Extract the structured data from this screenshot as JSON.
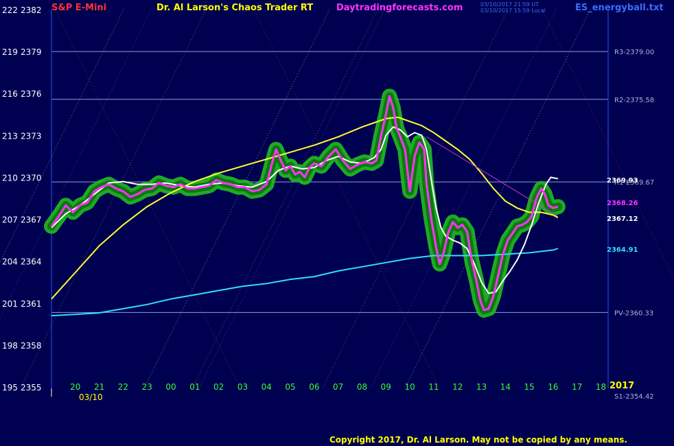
{
  "header": {
    "instrument": "S&P E-Mini",
    "title": "Dr. Al Larson's Chaos Trader RT",
    "website": "Daytradingforecasts.com",
    "file": "ES_energyball.txt",
    "stamp1": "03/10/2017 21:59 UT",
    "stamp2": "03/10/2017 15:59 Local"
  },
  "footer": {
    "copyright": "Copyright 2017, Dr. Al Larson. May not be copied by any means."
  },
  "colors": {
    "background": "#000050",
    "price_glow": "#22bb22",
    "price_core": "#ff33ff",
    "white_ma": "#ffffff",
    "yellow_ma": "#ffff33",
    "cyan_ma": "#33ddff",
    "level_line": "#8aa0d8",
    "axis": "#2255ff"
  },
  "chart_data": {
    "type": "line",
    "title": "S&P E-Mini",
    "date_label": "03/10",
    "year_label": "2017",
    "x_tick_labels": [
      "20",
      "21",
      "22",
      "23",
      "00",
      "01",
      "02",
      "03",
      "04",
      "05",
      "06",
      "07",
      "08",
      "09",
      "10",
      "11",
      "12",
      "13",
      "14",
      "15",
      "16",
      "17",
      "18"
    ],
    "y_ticks": [
      {
        "left": "222",
        "price": "2382"
      },
      {
        "left": "219",
        "price": "2379"
      },
      {
        "left": "216",
        "price": "2376"
      },
      {
        "left": "213",
        "price": "2373"
      },
      {
        "left": "210",
        "price": "2370"
      },
      {
        "left": "207",
        "price": "2367"
      },
      {
        "left": "204",
        "price": "2364"
      },
      {
        "left": "201",
        "price": "2361"
      },
      {
        "left": "198",
        "price": "2358"
      },
      {
        "left": "195",
        "price": "2355"
      }
    ],
    "ylim": [
      2355,
      2382
    ],
    "xlim": [
      19,
      42.3
    ],
    "levels": [
      {
        "name": "R3",
        "label": "R3-2379.00",
        "value": 2379.0
      },
      {
        "name": "R2",
        "label": "R2-2375.58",
        "value": 2375.58
      },
      {
        "name": "R1",
        "label": "R1-2369.67",
        "value": 2369.67
      },
      {
        "name": "PV",
        "label": "PV-2360.33",
        "value": 2360.33
      },
      {
        "name": "S1",
        "label": "S1-2354.42",
        "value": 2354.42
      }
    ],
    "last_values": [
      {
        "series": "white",
        "label": "2369.93",
        "value": 2369.93
      },
      {
        "series": "magenta",
        "label": "2368.26",
        "value": 2368.26
      },
      {
        "series": "yellow",
        "label": "2367.12",
        "value": 2367.12
      },
      {
        "series": "cyan",
        "label": "2364.91",
        "value": 2364.91
      }
    ],
    "series": [
      {
        "key": "price",
        "color": "#ff33ff",
        "points": [
          [
            19.0,
            2366.5
          ],
          [
            19.3,
            2367.2
          ],
          [
            19.6,
            2368.0
          ],
          [
            19.9,
            2367.5
          ],
          [
            20.2,
            2368.0
          ],
          [
            20.5,
            2368.2
          ],
          [
            20.8,
            2369.0
          ],
          [
            21.1,
            2369.3
          ],
          [
            21.4,
            2369.5
          ],
          [
            21.7,
            2369.2
          ],
          [
            22.0,
            2369.0
          ],
          [
            22.3,
            2368.6
          ],
          [
            22.6,
            2368.8
          ],
          [
            22.9,
            2369.1
          ],
          [
            23.2,
            2369.2
          ],
          [
            23.5,
            2369.6
          ],
          [
            23.8,
            2369.4
          ],
          [
            24.1,
            2369.3
          ],
          [
            24.4,
            2369.5
          ],
          [
            24.7,
            2369.2
          ],
          [
            25.0,
            2369.2
          ],
          [
            25.3,
            2369.3
          ],
          [
            25.6,
            2369.4
          ],
          [
            25.9,
            2369.8
          ],
          [
            26.2,
            2369.6
          ],
          [
            26.5,
            2369.5
          ],
          [
            26.8,
            2369.3
          ],
          [
            27.1,
            2369.3
          ],
          [
            27.4,
            2369.0
          ],
          [
            27.7,
            2369.1
          ],
          [
            28.0,
            2369.5
          ],
          [
            28.2,
            2370.8
          ],
          [
            28.4,
            2372.0
          ],
          [
            28.6,
            2371.2
          ],
          [
            28.8,
            2370.5
          ],
          [
            29.0,
            2370.8
          ],
          [
            29.2,
            2370.2
          ],
          [
            29.4,
            2370.4
          ],
          [
            29.6,
            2370.0
          ],
          [
            29.8,
            2370.7
          ],
          [
            30.0,
            2371.0
          ],
          [
            30.3,
            2370.8
          ],
          [
            30.6,
            2371.5
          ],
          [
            30.9,
            2372.0
          ],
          [
            31.2,
            2371.2
          ],
          [
            31.5,
            2370.6
          ],
          [
            31.8,
            2370.9
          ],
          [
            32.1,
            2371.1
          ],
          [
            32.4,
            2371.0
          ],
          [
            32.6,
            2371.2
          ],
          [
            32.8,
            2373.0
          ],
          [
            33.0,
            2374.5
          ],
          [
            33.15,
            2375.8
          ],
          [
            33.3,
            2375.0
          ],
          [
            33.45,
            2373.5
          ],
          [
            33.6,
            2372.9
          ],
          [
            33.8,
            2372.0
          ],
          [
            34.0,
            2369.0
          ],
          [
            34.2,
            2371.5
          ],
          [
            34.4,
            2372.5
          ],
          [
            34.6,
            2372.0
          ],
          [
            34.7,
            2369.5
          ],
          [
            34.9,
            2367.0
          ],
          [
            35.1,
            2365.0
          ],
          [
            35.25,
            2363.8
          ],
          [
            35.4,
            2364.5
          ],
          [
            35.6,
            2366.0
          ],
          [
            35.8,
            2366.8
          ],
          [
            36.0,
            2366.4
          ],
          [
            36.2,
            2366.6
          ],
          [
            36.4,
            2366.1
          ],
          [
            36.5,
            2365.0
          ],
          [
            36.6,
            2364.0
          ],
          [
            36.8,
            2362.5
          ],
          [
            36.95,
            2361.2
          ],
          [
            37.1,
            2360.5
          ],
          [
            37.3,
            2360.6
          ],
          [
            37.5,
            2361.5
          ],
          [
            37.7,
            2363.0
          ],
          [
            37.9,
            2364.5
          ],
          [
            38.1,
            2365.5
          ],
          [
            38.3,
            2366.0
          ],
          [
            38.5,
            2366.5
          ],
          [
            38.7,
            2366.6
          ],
          [
            38.9,
            2366.8
          ],
          [
            39.1,
            2367.2
          ],
          [
            39.3,
            2368.5
          ],
          [
            39.5,
            2369.2
          ],
          [
            39.65,
            2368.8
          ],
          [
            39.8,
            2368.0
          ],
          [
            40.0,
            2367.8
          ],
          [
            40.2,
            2367.9
          ]
        ]
      },
      {
        "key": "white",
        "color": "#ffffff",
        "points": [
          [
            19.0,
            2366.4
          ],
          [
            19.6,
            2367.4
          ],
          [
            20.2,
            2368.0
          ],
          [
            20.8,
            2368.8
          ],
          [
            21.4,
            2369.6
          ],
          [
            22.0,
            2369.7
          ],
          [
            22.6,
            2369.5
          ],
          [
            23.2,
            2369.5
          ],
          [
            23.8,
            2369.6
          ],
          [
            24.4,
            2369.4
          ],
          [
            25.0,
            2369.3
          ],
          [
            25.6,
            2369.5
          ],
          [
            26.2,
            2369.6
          ],
          [
            26.8,
            2369.4
          ],
          [
            27.4,
            2369.3
          ],
          [
            28.0,
            2369.7
          ],
          [
            28.5,
            2370.5
          ],
          [
            29.0,
            2370.8
          ],
          [
            29.5,
            2370.6
          ],
          [
            30.0,
            2370.7
          ],
          [
            30.5,
            2371.2
          ],
          [
            31.0,
            2371.5
          ],
          [
            31.5,
            2371.1
          ],
          [
            32.0,
            2371.0
          ],
          [
            32.5,
            2371.4
          ],
          [
            32.8,
            2372.0
          ],
          [
            33.0,
            2373.0
          ],
          [
            33.3,
            2373.6
          ],
          [
            33.6,
            2373.4
          ],
          [
            33.9,
            2372.9
          ],
          [
            34.2,
            2373.2
          ],
          [
            34.5,
            2373.0
          ],
          [
            34.7,
            2372.0
          ],
          [
            34.9,
            2369.8
          ],
          [
            35.1,
            2367.8
          ],
          [
            35.3,
            2366.4
          ],
          [
            35.5,
            2365.8
          ],
          [
            35.8,
            2365.5
          ],
          [
            36.1,
            2365.3
          ],
          [
            36.4,
            2364.9
          ],
          [
            36.7,
            2363.8
          ],
          [
            37.0,
            2362.5
          ],
          [
            37.3,
            2361.7
          ],
          [
            37.6,
            2361.8
          ],
          [
            37.9,
            2362.6
          ],
          [
            38.2,
            2363.3
          ],
          [
            38.5,
            2364.1
          ],
          [
            38.8,
            2365.2
          ],
          [
            39.1,
            2366.6
          ],
          [
            39.4,
            2368.2
          ],
          [
            39.7,
            2369.5
          ],
          [
            39.9,
            2370.0
          ],
          [
            40.2,
            2369.9
          ]
        ]
      },
      {
        "key": "yellow",
        "color": "#ffff33",
        "points": [
          [
            19.0,
            2361.3
          ],
          [
            20.0,
            2363.2
          ],
          [
            21.0,
            2365.1
          ],
          [
            22.0,
            2366.6
          ],
          [
            23.0,
            2367.9
          ],
          [
            24.0,
            2368.9
          ],
          [
            25.0,
            2369.7
          ],
          [
            26.0,
            2370.3
          ],
          [
            27.0,
            2370.8
          ],
          [
            28.0,
            2371.3
          ],
          [
            29.0,
            2371.8
          ],
          [
            30.0,
            2372.3
          ],
          [
            31.0,
            2372.9
          ],
          [
            32.0,
            2373.6
          ],
          [
            32.5,
            2373.9
          ],
          [
            33.0,
            2374.2
          ],
          [
            33.5,
            2374.3
          ],
          [
            34.0,
            2374.0
          ],
          [
            34.5,
            2373.7
          ],
          [
            35.0,
            2373.2
          ],
          [
            35.5,
            2372.6
          ],
          [
            36.0,
            2372.0
          ],
          [
            36.5,
            2371.3
          ],
          [
            37.0,
            2370.3
          ],
          [
            37.5,
            2369.2
          ],
          [
            38.0,
            2368.3
          ],
          [
            38.5,
            2367.8
          ],
          [
            39.0,
            2367.5
          ],
          [
            39.5,
            2367.5
          ],
          [
            40.0,
            2367.3
          ],
          [
            40.2,
            2367.12
          ]
        ]
      },
      {
        "key": "cyan",
        "color": "#33ddff",
        "points": [
          [
            19.0,
            2360.1
          ],
          [
            20.0,
            2360.2
          ],
          [
            21.0,
            2360.3
          ],
          [
            22.0,
            2360.6
          ],
          [
            23.0,
            2360.9
          ],
          [
            24.0,
            2361.3
          ],
          [
            25.0,
            2361.6
          ],
          [
            26.0,
            2361.9
          ],
          [
            27.0,
            2362.2
          ],
          [
            28.0,
            2362.4
          ],
          [
            29.0,
            2362.7
          ],
          [
            30.0,
            2362.9
          ],
          [
            31.0,
            2363.3
          ],
          [
            32.0,
            2363.6
          ],
          [
            33.0,
            2363.9
          ],
          [
            34.0,
            2364.2
          ],
          [
            35.0,
            2364.4
          ],
          [
            36.0,
            2364.4
          ],
          [
            37.0,
            2364.4
          ],
          [
            38.0,
            2364.5
          ],
          [
            39.0,
            2364.6
          ],
          [
            40.0,
            2364.8
          ],
          [
            40.2,
            2364.91
          ]
        ]
      },
      {
        "key": "magenta_trend",
        "color": "#cc33cc",
        "points": [
          [
            34.7,
            2372.9
          ],
          [
            40.2,
            2367.2
          ]
        ]
      }
    ]
  }
}
